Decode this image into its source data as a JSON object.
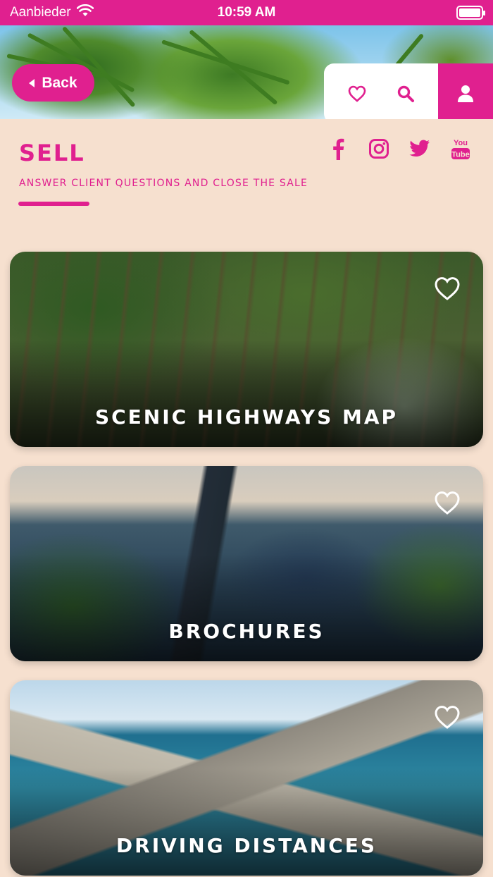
{
  "status_bar": {
    "carrier": "Aanbieder",
    "time": "10:59 AM"
  },
  "header": {
    "back_label": "Back"
  },
  "page": {
    "title": "SELL",
    "subtitle": "ANSWER CLIENT QUESTIONS AND CLOSE THE SALE"
  },
  "social": [
    "facebook-icon",
    "instagram-icon",
    "twitter-icon",
    "youtube-icon"
  ],
  "youtube_text": {
    "top": "You",
    "bottom": "Tube"
  },
  "cards": [
    {
      "title": "SCENIC HIGHWAYS MAP"
    },
    {
      "title": "BROCHURES"
    },
    {
      "title": "DRIVING DISTANCES"
    }
  ],
  "colors": {
    "brand": "#e0208f",
    "background": "#f6e0cf"
  }
}
